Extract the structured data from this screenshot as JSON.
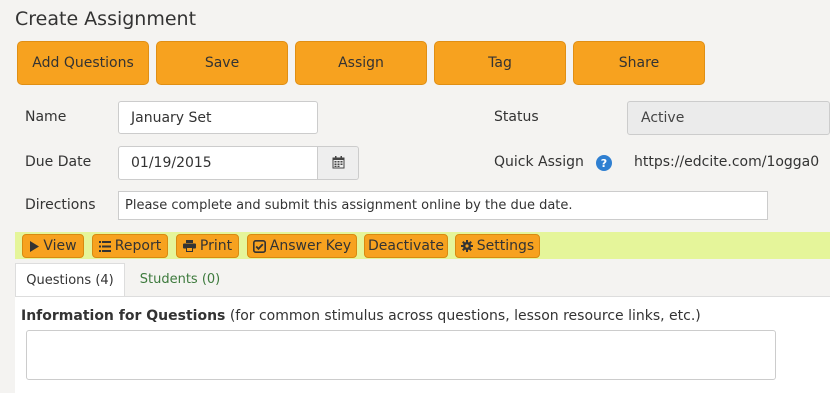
{
  "page": {
    "title": "Create Assignment"
  },
  "toolbar": {
    "add_questions": "Add Questions",
    "save": "Save",
    "assign": "Assign",
    "tag": "Tag",
    "share": "Share"
  },
  "form": {
    "name_label": "Name",
    "name_value": "January Set",
    "status_label": "Status",
    "status_value": "Active",
    "due_date_label": "Due Date",
    "due_date_value": "01/19/2015",
    "quick_assign_label": "Quick Assign",
    "quick_assign_url": "https://edcite.com/1ogga0",
    "directions_label": "Directions",
    "directions_value": "Please complete and submit this assignment online by the due date."
  },
  "actions": {
    "view": "View",
    "report": "Report",
    "print": "Print",
    "answer_key": "Answer Key",
    "deactivate": "Deactivate",
    "settings": "Settings"
  },
  "tabs": [
    {
      "label": "Questions (4)",
      "active": true
    },
    {
      "label": "Students (0)",
      "active": false
    }
  ],
  "info": {
    "heading_bold": "Information for Questions",
    "heading_rest": " (for common stimulus across questions, lesson resource links, etc.)",
    "value": ""
  },
  "colors": {
    "accent_orange": "#f7a21f",
    "action_bar": "#e5f59a",
    "link_green": "#3d7a3d",
    "help_blue": "#2f7fd1"
  },
  "icons": [
    "play-icon",
    "list-icon",
    "print-icon",
    "check-icon",
    "gear-icon",
    "calendar-icon",
    "help-icon"
  ]
}
